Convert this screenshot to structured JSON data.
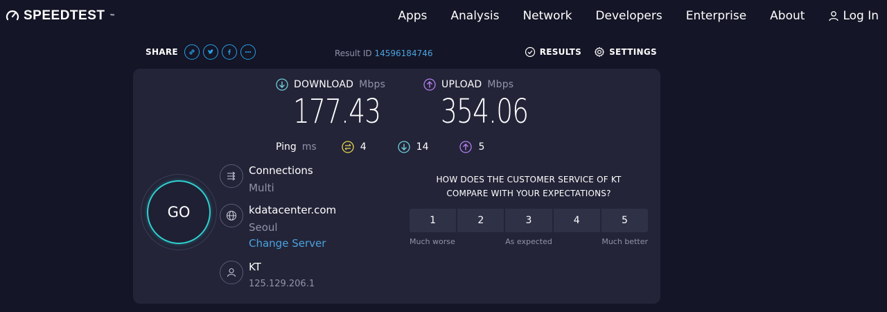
{
  "brand": {
    "name": "SPEEDTEST",
    "tm": "™"
  },
  "nav": {
    "links": [
      "Apps",
      "Analysis",
      "Network",
      "Developers",
      "Enterprise",
      "About"
    ],
    "login": "Log In"
  },
  "subbar": {
    "share_label": "SHARE",
    "result_id_label": "Result ID",
    "result_id": "14596184746",
    "results_label": "RESULTS",
    "settings_label": "SETTINGS"
  },
  "download": {
    "label": "DOWNLOAD",
    "unit": "Mbps",
    "value": "177.43"
  },
  "upload": {
    "label": "UPLOAD",
    "unit": "Mbps",
    "value": "354.06"
  },
  "ping": {
    "label": "Ping",
    "unit": "ms",
    "idle": "4",
    "download": "14",
    "upload": "5"
  },
  "go_label": "GO",
  "connections": {
    "title": "Connections",
    "value": "Multi"
  },
  "server": {
    "host": "kdatacenter.com",
    "location": "Seoul",
    "change_label": "Change Server"
  },
  "isp": {
    "name": "KT",
    "ip": "125.129.206.1"
  },
  "survey": {
    "question_line1": "HOW DOES THE CUSTOMER SERVICE OF KT",
    "question_line2": "COMPARE WITH YOUR EXPECTATIONS?",
    "ratings": [
      "1",
      "2",
      "3",
      "4",
      "5"
    ],
    "scale_low": "Much worse",
    "scale_mid": "As expected",
    "scale_high": "Much better"
  },
  "colors": {
    "background": "#141526",
    "card": "#232438",
    "download_accent": "#6fd0d8",
    "upload_accent": "#b77ef0",
    "idle_accent": "#e8d44d",
    "link": "#4aa3df",
    "go_ring": "#2fd0d0"
  }
}
